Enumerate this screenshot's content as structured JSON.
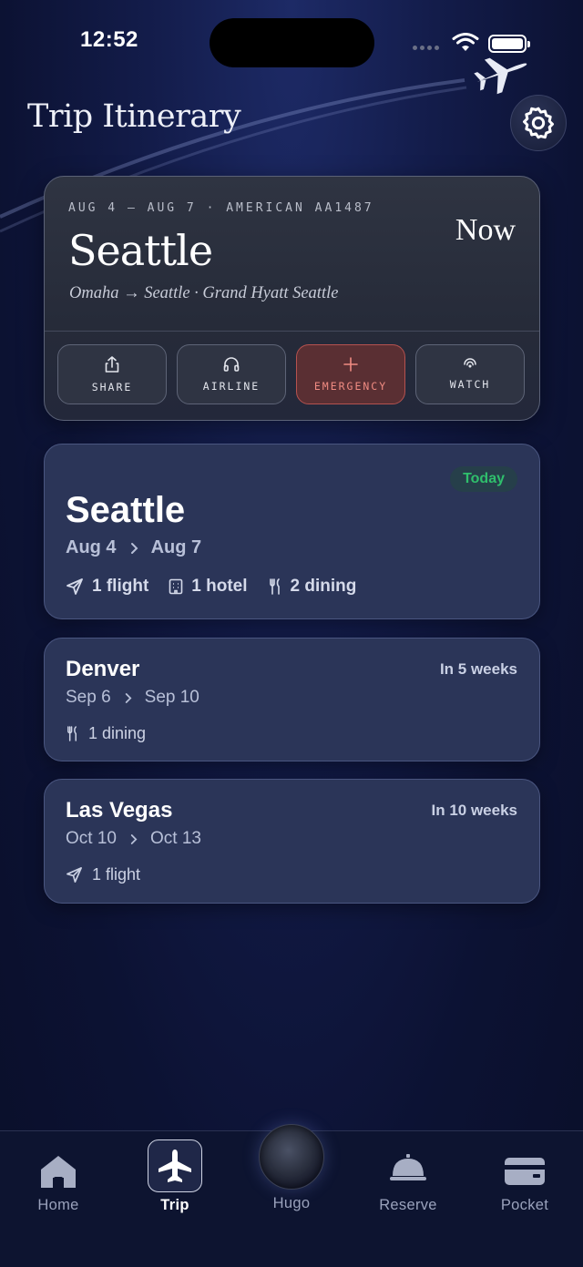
{
  "status": {
    "time": "12:52"
  },
  "header": {
    "title": "Trip Itinerary"
  },
  "current": {
    "meta": "AUG 4 — AUG 7 · AMERICAN AA1487",
    "city": "Seattle",
    "route": "Omaha → Seattle · Grand Hyatt Seattle",
    "badge": "Now",
    "actions": {
      "share": "SHARE",
      "airline": "AIRLINE",
      "emergency": "EMERGENCY",
      "watch": "WATCH"
    }
  },
  "trips": {
    "seattle": {
      "city": "Seattle",
      "badge": "Today",
      "start": "Aug 4",
      "end": "Aug 7",
      "flights": "1 flight",
      "hotels": "1 hotel",
      "dining": "2 dining"
    },
    "denver": {
      "city": "Denver",
      "when": "In 5 weeks",
      "start": "Sep 6",
      "end": "Sep 10",
      "dining": "1 dining"
    },
    "vegas": {
      "city": "Las Vegas",
      "when": "In 10 weeks",
      "start": "Oct 10",
      "end": "Oct 13",
      "flights": "1 flight"
    }
  },
  "tabs": {
    "home": "Home",
    "trip": "Trip",
    "hugo": "Hugo",
    "reserve": "Reserve",
    "pocket": "Pocket"
  },
  "colors": {
    "accent_today": "#2fbf6c",
    "emergency": "#f08b82",
    "card_bg": "#2b3558"
  }
}
